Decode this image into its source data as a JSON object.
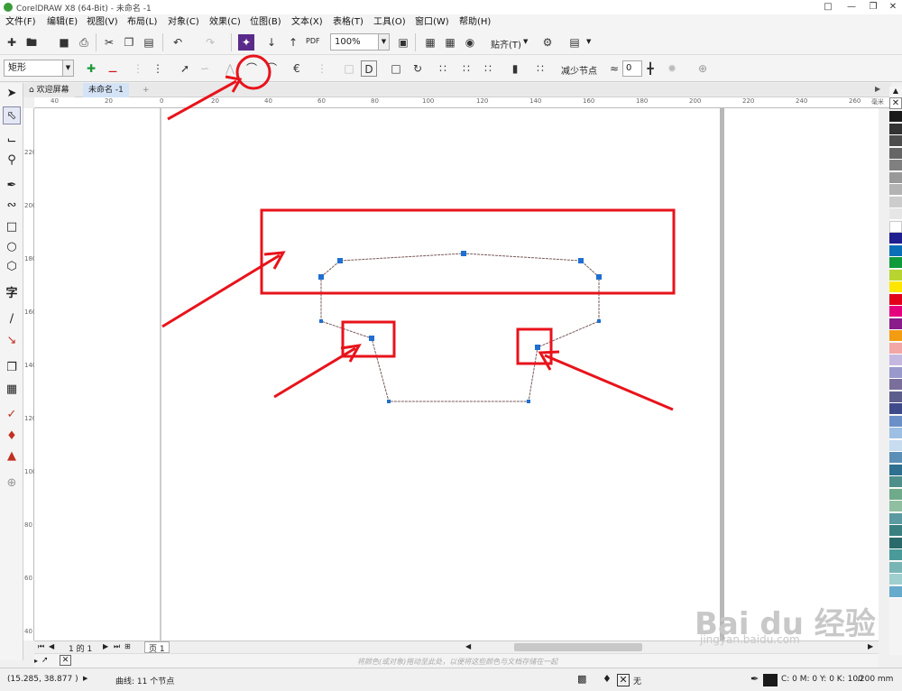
{
  "window": {
    "title": "CorelDRAW X8 (64-Bit) - 未命名 -1"
  },
  "menu": [
    "文件(F)",
    "编辑(E)",
    "视图(V)",
    "布局(L)",
    "对象(C)",
    "效果(C)",
    "位图(B)",
    "文本(X)",
    "表格(T)",
    "工具(O)",
    "窗口(W)",
    "帮助(H)"
  ],
  "toolbar": {
    "zoom": "100%",
    "snap_label": "贴齐(T)",
    "pdf_label": "PDF"
  },
  "property_bar": {
    "selection_mode": "矩形",
    "reduce_nodes_label": "减少节点",
    "smoothness_value": "0"
  },
  "tabs": {
    "welcome": "欢迎屏幕",
    "document": "未命名 -1"
  },
  "rulers": {
    "h_ticks": [
      "40",
      "20",
      "0",
      "20",
      "40",
      "60",
      "80",
      "100",
      "120",
      "140",
      "160",
      "180",
      "200",
      "220",
      "240",
      "260"
    ],
    "h_unit": "毫米",
    "v_ticks": [
      "220",
      "200",
      "180",
      "160",
      "140",
      "120",
      "100",
      "80",
      "60",
      "40",
      "20"
    ]
  },
  "page_nav": {
    "page_text": "1 的 1",
    "page_tab": "页 1"
  },
  "hint_text": "将颜色(或对象)拖动至此处，以便将这些颜色与文档存储在一起",
  "status": {
    "coords": "(15.285, 38.877 )",
    "object_info": "曲线: 11 个节点",
    "fill_none": "无",
    "color_values": "C: 0 M: 0 Y: 0 K: 100",
    "outline_width": ".200 mm"
  },
  "watermark": {
    "brand": "Bai du 经验",
    "url": "jingyan.baidu.com"
  },
  "palette_colors": [
    "#1a1a1a",
    "#333333",
    "#4d4d4d",
    "#666666",
    "#808080",
    "#999999",
    "#b3b3b3",
    "#cccccc",
    "#e6e6e6",
    "#ffffff",
    "#1f1f8f",
    "#0b6fb8",
    "#109a3c",
    "#b8d430",
    "#ffe600",
    "#e2001a",
    "#e5007e",
    "#8b1a8b",
    "#f39c12",
    "#f2a6a6",
    "#c5b8e0",
    "#9999cc",
    "#7a6f9b",
    "#5e5e8c",
    "#3f4a8a",
    "#6b8fc7",
    "#9dbfe3",
    "#c7dcef",
    "#5b8fb5",
    "#2f6f8f",
    "#4f8f8a",
    "#6faa8a",
    "#8fbfa0",
    "#5b9aa0",
    "#3a8080",
    "#2a6a6a",
    "#4a9a9a",
    "#7ab5b5",
    "#a0cfcf",
    "#66aacc"
  ],
  "accent": {
    "annotation_red": "#e8131b",
    "node_blue": "#1f6fd1",
    "path_color": "#7a5a5a"
  }
}
